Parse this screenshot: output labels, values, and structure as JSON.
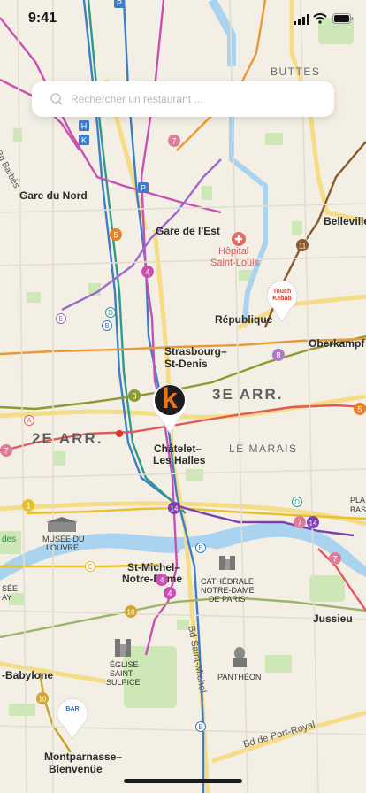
{
  "status_bar": {
    "time": "9:41"
  },
  "search": {
    "placeholder": "Rechercher un restaurant ..."
  },
  "map": {
    "labels": {
      "buttes": "BUTTES",
      "bd_barbes": "Bd Barbès",
      "gare_du_nord": "Gare du Nord",
      "gare_de_lest": "Gare de l'Est",
      "hopital_line1": "Hôpital",
      "hopital_line2": "Saint-Louis",
      "belleville": "Belleville",
      "republique": "République",
      "oberkampf": "Oberkampf",
      "strasbourg_line1": "Strasbourg–",
      "strasbourg_line2": "St-Denis",
      "arr3": "3E ARR.",
      "arr2": "2E ARR.",
      "le_marais": "LE MARAIS",
      "chatelet_line1": "Châtelet–",
      "chatelet_line2": "Les Halles",
      "musee_line1": "MUSÉE DU",
      "musee_line2": "LOUVRE",
      "place_line1": "PLA",
      "place_line2": "BAS",
      "des": "des",
      "ee": "SÉE",
      "ay": "AY",
      "stmichel_line1": "St-Michel–",
      "stmichel_line2": "Notre-Dame",
      "cathedrale_line1": "CATHÉDRALE",
      "cathedrale_line2": "NOTRE-DAME",
      "cathedrale_line3": "DE PARIS",
      "jussieu": "Jussieu",
      "babylone": "-Babylone",
      "eglise_line1": "ÉGLISE",
      "eglise_line2": "SAINT-",
      "eglise_line3": "SULPICE",
      "pantheon": "PANTHÉON",
      "bd_saint_michel": "Bd Saint-Michel",
      "bd_port_royal": "Bd de Port-Royal",
      "montparnasse_line1": "Montparnasse–",
      "montparnasse_line2": "Bienvenüe"
    },
    "badges": {
      "p": "P",
      "h": "H",
      "k": "K",
      "d": "D",
      "b": "B",
      "e": "E",
      "a": "A",
      "c": "C",
      "n3": "3",
      "n4": "4",
      "n5": "5",
      "n7": "7",
      "n8": "8",
      "n10": "10",
      "n11": "11",
      "n14": "14",
      "n1": "1"
    },
    "pins": [
      {
        "name": "Touch Kebab",
        "logo_text": "Touch Kebab",
        "color": "#e2372b"
      },
      {
        "name": "K restaurant",
        "logo_text": "k",
        "color": "#e8751a"
      },
      {
        "name": "Bar Bistrot",
        "logo_text": "BAR",
        "color": "#2e6bb5"
      }
    ]
  },
  "colors": {
    "water": "#a9d3ef",
    "park": "#c8e6b0",
    "line_orange": "#e89a3a",
    "line_teal": "#2e9a8a",
    "line_pink": "#c94fb4",
    "line_blue": "#3d7cc9",
    "line_red": "#e05a5a",
    "line_purple": "#9b6bc7"
  }
}
